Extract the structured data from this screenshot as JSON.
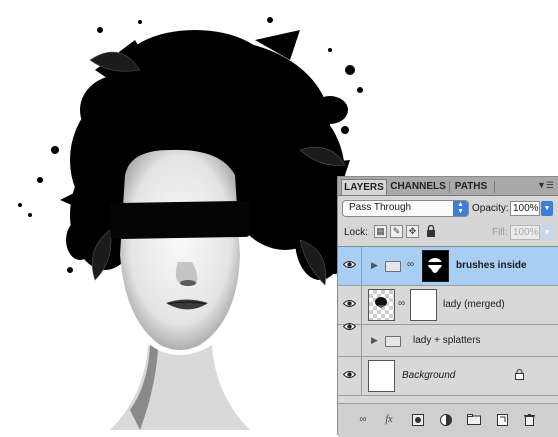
{
  "panel": {
    "tabs": [
      {
        "label": "LAYERS",
        "active": true
      },
      {
        "label": "CHANNELS",
        "active": false
      },
      {
        "label": "PATHS",
        "active": false
      }
    ],
    "menu_icon": "panel-menu-icon",
    "blend_mode": "Pass Through",
    "opacity_label": "Opacity:",
    "opacity_value": "100%",
    "lock_label": "Lock:",
    "fill_label": "Fill:",
    "fill_value": "100%",
    "layers": [
      {
        "name": "brushes inside",
        "kind": "group",
        "selected": true
      },
      {
        "name": "lady (merged)",
        "kind": "masked-layer",
        "selected": false
      },
      {
        "name": "lady + splatters",
        "kind": "group",
        "selected": false
      },
      {
        "name": "Background",
        "kind": "background",
        "locked": true,
        "selected": false
      }
    ],
    "footer_icons": [
      "link-icon",
      "fx-icon",
      "add-mask-icon",
      "adjustment-icon",
      "new-group-icon",
      "new-layer-icon",
      "trash-icon"
    ],
    "footer_labels": {
      "fx": "fx"
    },
    "colors": {
      "selection": "#a9cef3",
      "accent": "#3d7fd6",
      "panel": "#d6d6d6"
    }
  }
}
